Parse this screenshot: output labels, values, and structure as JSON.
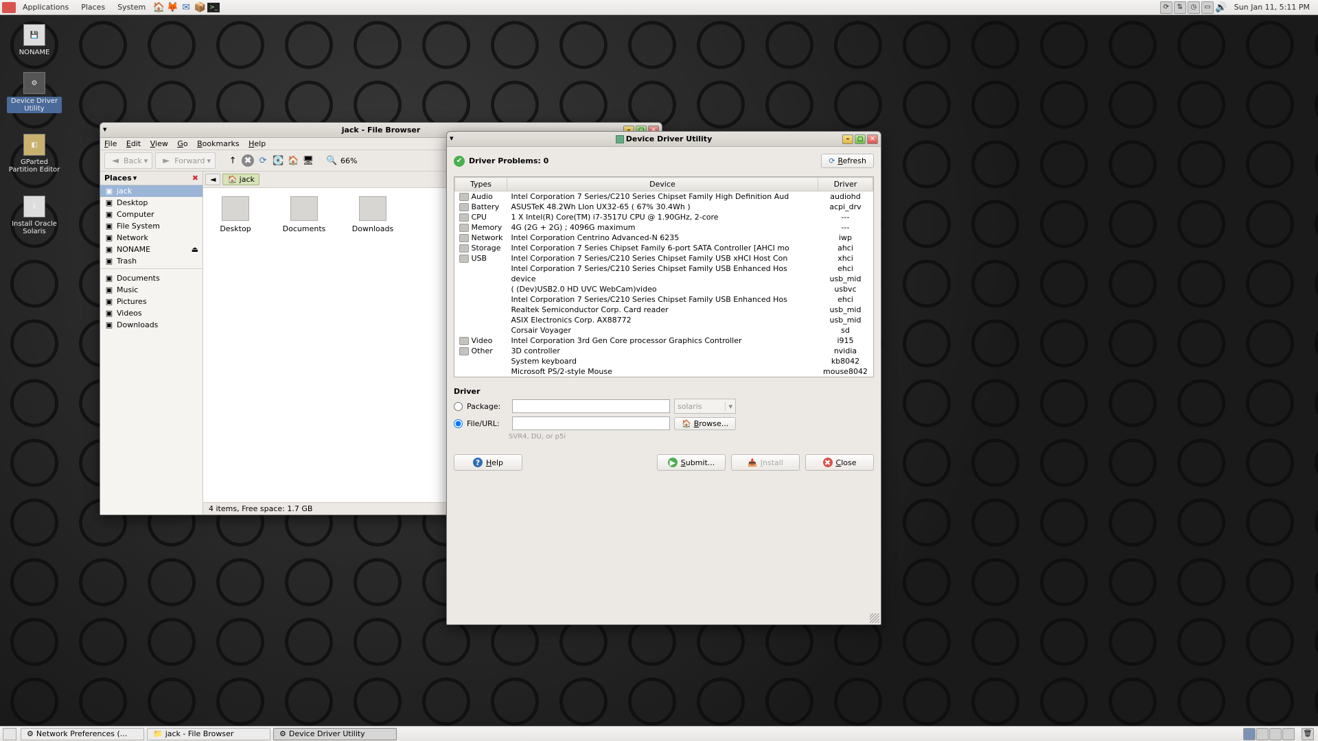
{
  "top_panel": {
    "menus": [
      "Applications",
      "Places",
      "System"
    ],
    "clock": "Sun Jan 11,  5:11 PM"
  },
  "desktop_icons": [
    {
      "label": "NONAME"
    },
    {
      "label": "Device Driver Utility"
    },
    {
      "label": "GParted Partition Editor"
    },
    {
      "label": "Install Oracle Solaris"
    }
  ],
  "taskbar": {
    "buttons": [
      "Network Preferences (...",
      "jack - File Browser",
      "Device Driver Utility"
    ]
  },
  "file_browser": {
    "title": "jack - File Browser",
    "menus": [
      "File",
      "Edit",
      "View",
      "Go",
      "Bookmarks",
      "Help"
    ],
    "back": "Back",
    "forward": "Forward",
    "zoom": "66%",
    "sidebar_header": "Places",
    "sidebar": [
      {
        "label": "jack",
        "sel": true
      },
      {
        "label": "Desktop"
      },
      {
        "label": "Computer"
      },
      {
        "label": "File System"
      },
      {
        "label": "Network"
      },
      {
        "label": "NONAME",
        "eject": true
      },
      {
        "label": "Trash"
      }
    ],
    "sidebar2": [
      {
        "label": "Documents"
      },
      {
        "label": "Music"
      },
      {
        "label": "Pictures"
      },
      {
        "label": "Videos"
      },
      {
        "label": "Downloads"
      }
    ],
    "path": "jack",
    "files": [
      "Desktop",
      "Documents",
      "Downloads"
    ],
    "status": "4 items, Free space: 1.7 GB"
  },
  "ddu": {
    "title": "Device Driver Utility",
    "problems_label": "Driver Problems: 0",
    "refresh": "Refresh",
    "columns": [
      "Types",
      "Device",
      "Driver"
    ],
    "rows": [
      {
        "type": "Audio",
        "device": "Intel Corporation 7 Series/C210 Series Chipset Family High Definition Aud",
        "driver": "audiohd"
      },
      {
        "type": "Battery",
        "device": "ASUSTeK 48.2Wh LIon UX32-65 ( 67%  30.4Wh )",
        "driver": "acpi_drv"
      },
      {
        "type": "CPU",
        "device": "1 X Intel(R) Core(TM) i7-3517U CPU @ 1.90GHz, 2-core",
        "driver": "---"
      },
      {
        "type": "Memory",
        "device": " 4G (2G + 2G) ;  4096G maximum",
        "driver": "---"
      },
      {
        "type": "Network",
        "device": "Intel Corporation Centrino Advanced-N 6235",
        "driver": "iwp"
      },
      {
        "type": "Storage",
        "device": "Intel Corporation 7 Series Chipset Family 6-port SATA Controller [AHCI mo",
        "driver": "ahci"
      },
      {
        "type": "USB",
        "device": "Intel Corporation 7 Series/C210 Series Chipset Family USB xHCI Host Con",
        "driver": "xhci"
      },
      {
        "type": "",
        "device": "Intel Corporation 7 Series/C210 Series Chipset Family USB Enhanced Hos",
        "driver": "ehci"
      },
      {
        "type": "",
        "device": "device",
        "driver": "usb_mid"
      },
      {
        "type": "",
        "device": "(               (Dev)USB2.0 HD UVC WebCam)video",
        "driver": "usbvc"
      },
      {
        "type": "",
        "device": "Intel Corporation 7 Series/C210 Series Chipset Family USB Enhanced Hos",
        "driver": "ehci"
      },
      {
        "type": "",
        "device": "Realtek Semiconductor Corp. Card reader",
        "driver": "usb_mid"
      },
      {
        "type": "",
        "device": "ASIX Electronics Corp. AX88772",
        "driver": "usb_mid"
      },
      {
        "type": "",
        "device": "Corsair Voyager",
        "driver": "sd"
      },
      {
        "type": "Video",
        "device": "Intel Corporation 3rd Gen Core processor Graphics Controller",
        "driver": "i915"
      },
      {
        "type": "Other",
        "device": "3D controller",
        "driver": "nvidia"
      },
      {
        "type": "",
        "device": "System keyboard",
        "driver": "kb8042"
      },
      {
        "type": "",
        "device": "Microsoft PS/2-style Mouse",
        "driver": "mouse8042"
      }
    ],
    "driver_section": "Driver",
    "package_label": "Package:",
    "fileurl_label": "File/URL:",
    "combo_value": "solaris",
    "browse": "Browse...",
    "hint": "SVR4, DU, or p5i",
    "help": "Help",
    "submit": "Submit...",
    "install": "Install",
    "close": "Close"
  }
}
